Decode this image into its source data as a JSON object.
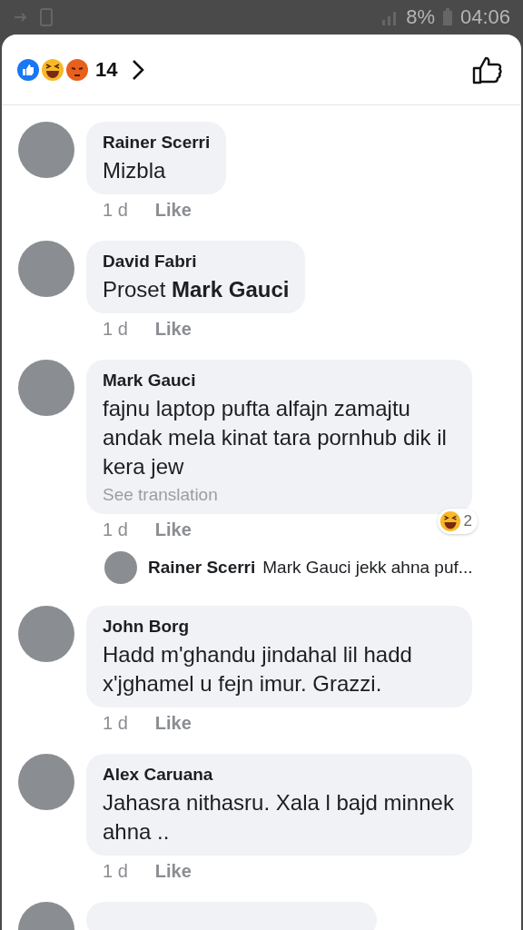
{
  "status_bar": {
    "battery": "8%",
    "time": "04:06"
  },
  "reactions": {
    "count": "14"
  },
  "comments": [
    {
      "kind": "comment",
      "author": "Rainer Scerri",
      "text": "Mizbla",
      "time": "1 d",
      "like": "Like"
    },
    {
      "kind": "comment",
      "author": "David Fabri",
      "text": "Proset **Mark Gauci**",
      "time": "1 d",
      "like": "Like"
    },
    {
      "kind": "comment",
      "author": "Mark Gauci",
      "text": "fajnu laptop pufta alfajn zamajtu andak mela kinat tara pornhub dik il kera jew",
      "translation": "See translation",
      "time": "1 d",
      "like": "Like",
      "reaction_count": "2"
    },
    {
      "kind": "reply",
      "author": "Rainer Scerri",
      "text": "Mark Gauci jekk ahna puf..."
    },
    {
      "kind": "comment",
      "author": "John Borg",
      "text": "Hadd m'ghandu jindahal lil hadd x'jghamel u fejn imur. Grazzi.",
      "time": "1 d",
      "like": "Like"
    },
    {
      "kind": "comment",
      "author": "Alex Caruana",
      "text": "Jahasra nithasru. Xala l bajd minnek ahna ..",
      "time": "1 d",
      "like": "Like"
    }
  ]
}
